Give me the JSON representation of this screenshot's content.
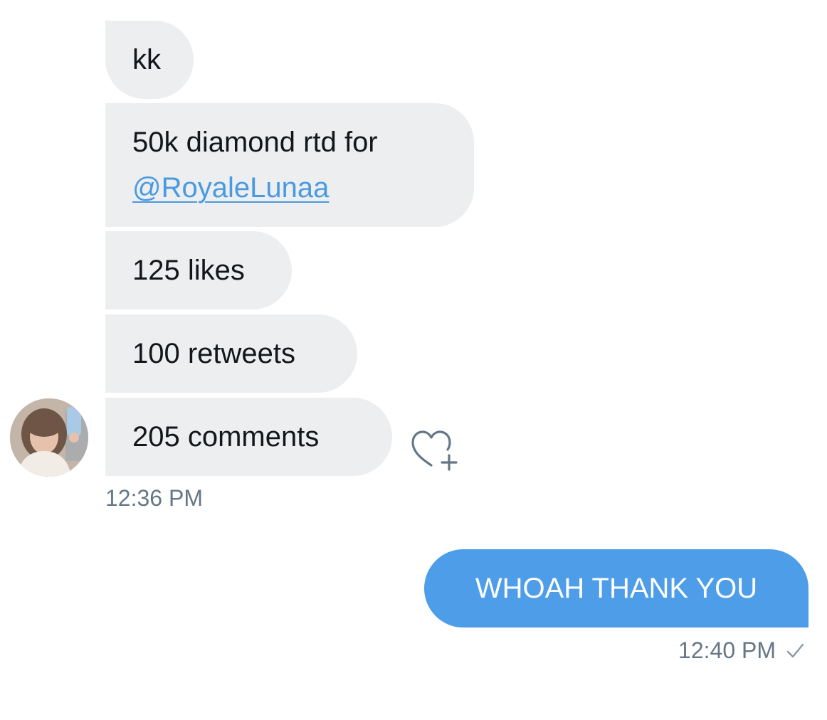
{
  "conversation": {
    "incoming": [
      {
        "text": "kk"
      },
      {
        "text": "50k diamond rtd for",
        "mention": "@RoyaleLunaa"
      },
      {
        "text": "125 likes"
      },
      {
        "text": "100 retweets"
      },
      {
        "text": "205 comments"
      }
    ],
    "incoming_time": "12:36 PM",
    "outgoing": [
      {
        "text": "WHOAH THANK YOU"
      }
    ],
    "outgoing_time": "12:40 PM",
    "outgoing_status": "sent"
  },
  "icons": {
    "reaction": "heart-plus-icon",
    "status": "checkmark-icon"
  },
  "colors": {
    "incoming_bubble": "#eceef0",
    "outgoing_bubble": "#4d9de8",
    "link": "#4a9ae0",
    "timestamp": "#657786"
  }
}
